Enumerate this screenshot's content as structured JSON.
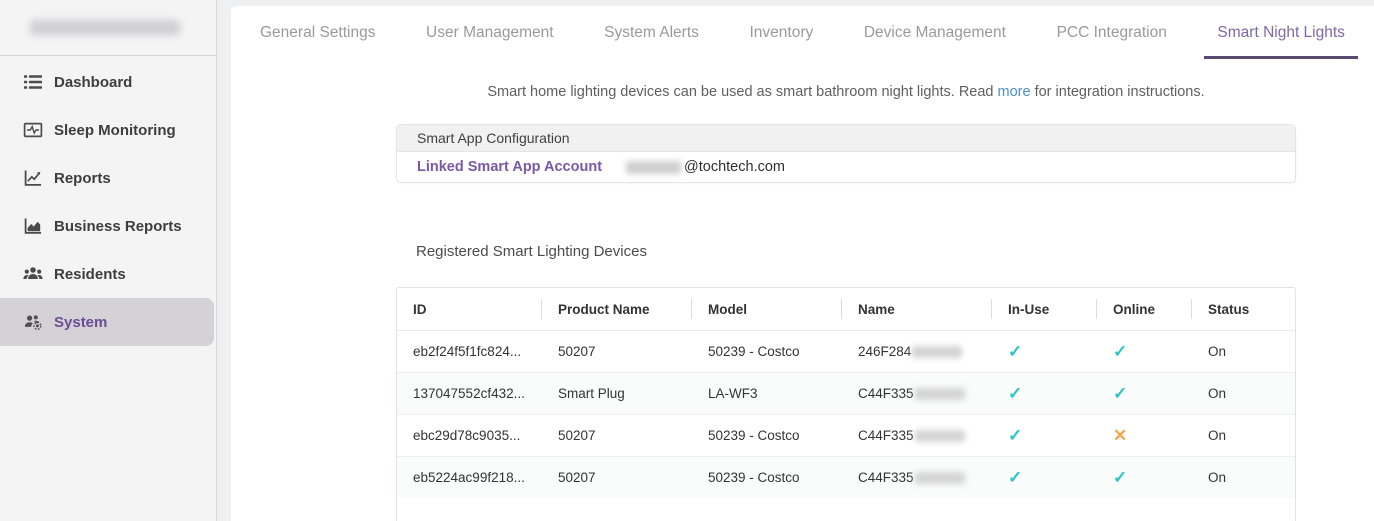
{
  "sidebar": {
    "brand_label_redacted": true,
    "items": [
      {
        "label": "Dashboard",
        "icon": "list-icon",
        "active": false
      },
      {
        "label": "Sleep Monitoring",
        "icon": "sleep-chart-icon",
        "active": false
      },
      {
        "label": "Reports",
        "icon": "line-chart-icon",
        "active": false
      },
      {
        "label": "Business Reports",
        "icon": "area-chart-icon",
        "active": false
      },
      {
        "label": "Residents",
        "icon": "users-icon",
        "active": false
      },
      {
        "label": "System",
        "icon": "users-gear-icon",
        "active": true
      }
    ]
  },
  "tabs": [
    {
      "label": "General Settings",
      "active": false
    },
    {
      "label": "User Management",
      "active": false
    },
    {
      "label": "System Alerts",
      "active": false
    },
    {
      "label": "Inventory",
      "active": false
    },
    {
      "label": "Device Management",
      "active": false
    },
    {
      "label": "PCC Integration",
      "active": false
    },
    {
      "label": "Smart Night Lights",
      "active": true
    }
  ],
  "description": {
    "before": "Smart home lighting devices can be used as smart bathroom night lights. Read ",
    "link": "more",
    "after": " for integration instructions."
  },
  "config": {
    "header": "Smart App Configuration",
    "account_label": "Linked Smart App Account",
    "account_user_redacted": true,
    "account_domain": "@tochtech.com"
  },
  "devices": {
    "heading": "Registered Smart Lighting Devices",
    "columns": [
      "ID",
      "Product Name",
      "Model",
      "Name",
      "In-Use",
      "Online",
      "Status"
    ],
    "rows": [
      {
        "id": "eb2f24f5f1fc824...",
        "product_name": "50207",
        "model": "50239 - Costco",
        "name_prefix": "246F284",
        "name_suffix_redacted": true,
        "in_use": true,
        "online": true,
        "status": "On"
      },
      {
        "id": "137047552cf432...",
        "product_name": "Smart Plug",
        "model": "LA-WF3",
        "name_prefix": "C44F335",
        "name_suffix_redacted": true,
        "in_use": true,
        "online": true,
        "status": "On"
      },
      {
        "id": "ebc29d78c9035...",
        "product_name": "50207",
        "model": "50239 - Costco",
        "name_prefix": "C44F335",
        "name_suffix_redacted": true,
        "in_use": true,
        "online": false,
        "status": "On"
      },
      {
        "id": "eb5224ac99f218...",
        "product_name": "50207",
        "model": "50239 - Costco",
        "name_prefix": "C44F335",
        "name_suffix_redacted": true,
        "in_use": true,
        "online": true,
        "status": "On"
      }
    ]
  },
  "colors": {
    "accent_purple": "#7b57a5",
    "active_tab_text": "#7f68a6",
    "tab_underline": "#5a4971",
    "active_sidebar_bg": "#d5d2d7",
    "check_teal": "#2cc5c5",
    "cross_orange": "#f5a54c",
    "link_blue": "#4a90c4"
  }
}
